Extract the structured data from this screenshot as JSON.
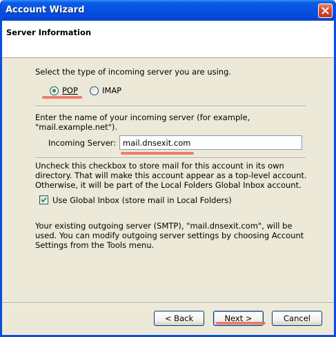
{
  "window": {
    "title": "Account Wizard"
  },
  "header": {
    "title": "Server Information"
  },
  "incoming": {
    "prompt": "Select the type of incoming server you are using.",
    "options": [
      {
        "label": "POP",
        "selected": true
      },
      {
        "label": "IMAP",
        "selected": false
      }
    ]
  },
  "server": {
    "prompt_line1": "Enter the name of your incoming server (for example,",
    "prompt_line2": "\"mail.example.net\").",
    "label": "Incoming Server:",
    "value": "mail.dnsexit.com"
  },
  "global_inbox": {
    "desc_line1": "Uncheck this checkbox to store mail for this account in its own",
    "desc_line2": "directory. That will make this account appear as a top-level account.",
    "desc_line3": "Otherwise, it will be part of the Local Folders Global Inbox account.",
    "checkbox_label": "Use Global Inbox (store mail in Local Folders)",
    "checked": true
  },
  "outgoing": {
    "line1": "Your existing outgoing server (SMTP), \"mail.dnsexit.com\", will be",
    "line2": "used. You can modify outgoing server settings by choosing Account",
    "line3": "Settings from the Tools menu."
  },
  "buttons": {
    "back": "< Back",
    "next": "Next >",
    "cancel": "Cancel"
  },
  "colors": {
    "title_bar": "#0551e0",
    "highlight": "#ef6a5a",
    "radio_dot": "#21a121"
  }
}
